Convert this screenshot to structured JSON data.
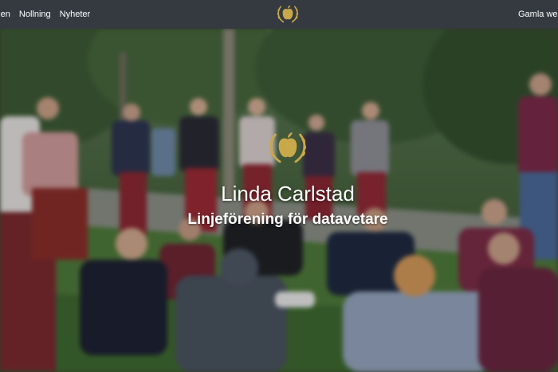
{
  "nav": {
    "links": [
      "ingen",
      "Nollning",
      "Nyheter"
    ],
    "right_link": "Gamla webb",
    "logo_icon": "laurel-apple-logo-icon"
  },
  "hero": {
    "title": "Linda Carlstad",
    "subtitle": "Linjeförening för datavetare",
    "logo_icon": "laurel-apple-logo-icon",
    "background": "blurred-group-photo-outdoors"
  },
  "colors": {
    "navbar": "#343a40",
    "gold": "#c9a84a",
    "text": "#ffffff"
  }
}
